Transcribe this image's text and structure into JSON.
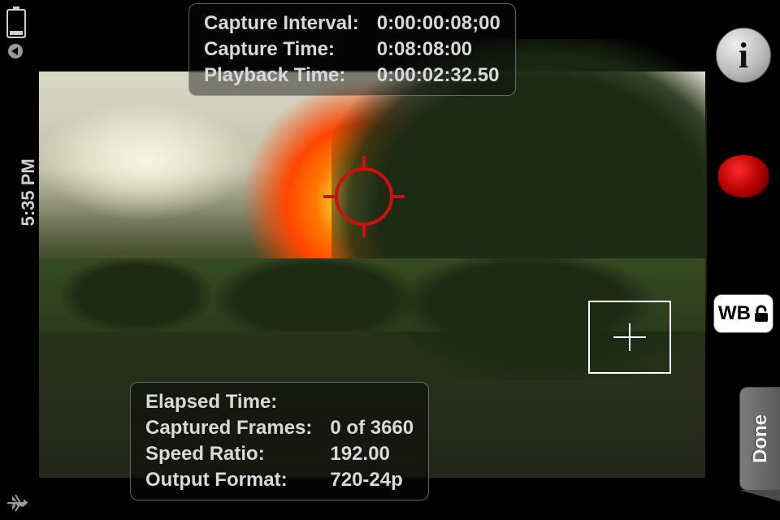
{
  "status": {
    "time": "5:35 PM",
    "airplane_mode": true,
    "battery_level": "low"
  },
  "timing_panel": {
    "capture_interval_label": "Capture Interval:",
    "capture_interval_value": "0:00:00:08;00",
    "capture_time_label": "Capture Time:",
    "capture_time_value": "0:08:08:00",
    "playback_time_label": "Playback Time:",
    "playback_time_value": "0:00:02:32.50"
  },
  "progress_panel": {
    "elapsed_label": "Elapsed Time:",
    "elapsed_value": "",
    "frames_label": "Captured Frames:",
    "frames_value": "0 of 3660",
    "ratio_label": "Speed Ratio:",
    "ratio_value": "192.00",
    "format_label": "Output Format:",
    "format_value": "720-24p"
  },
  "rail": {
    "info_glyph": "i",
    "wb_label": "WB",
    "done_label": "Done"
  }
}
